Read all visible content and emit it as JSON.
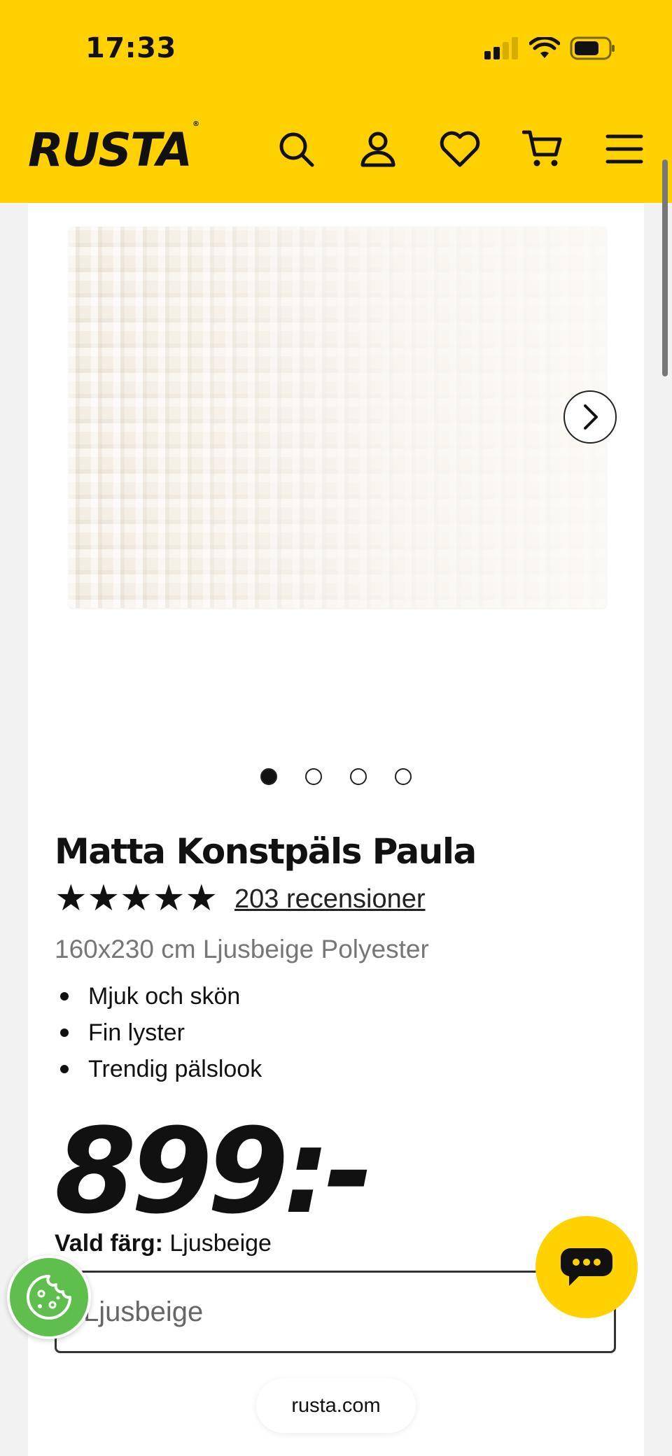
{
  "status_bar": {
    "time": "17:33"
  },
  "header": {
    "logo": "RUSTA",
    "icons": [
      "search-icon",
      "user-icon",
      "heart-icon",
      "cart-icon",
      "menu-icon"
    ]
  },
  "gallery": {
    "image_count": 4,
    "active_index": 0
  },
  "product": {
    "title": "Matta Konstpäls Paula",
    "rating_stars": "★★★★★",
    "rating_value": 5,
    "reviews": "203 recensioner",
    "subtitle": "160x230 cm Ljusbeige Polyester",
    "features": [
      "Mjuk och skön",
      "Fin lyster",
      "Trendig pälslook"
    ],
    "price": "899",
    "price_suffix": ":-"
  },
  "color_picker": {
    "label": "Vald färg:",
    "value": "Ljusbeige",
    "selected_option": "Ljusbeige"
  },
  "browser": {
    "url": "rusta.com"
  },
  "colors": {
    "brand_yellow": "#ffd100",
    "cookie_green": "#5fbf4c"
  }
}
